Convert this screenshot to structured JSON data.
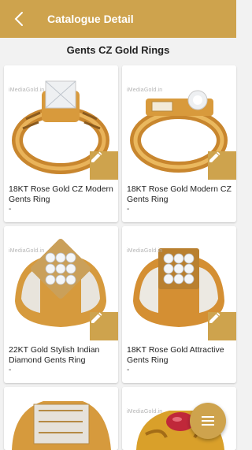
{
  "header": {
    "title": "Catalogue Detail",
    "back_icon": "back-chevron-icon"
  },
  "catalogue": {
    "title": "Gents CZ Gold Rings"
  },
  "products": [
    {
      "name": "18KT Rose Gold CZ Modern Gents Ring",
      "price": "-",
      "watermark": "iMediaGold.in"
    },
    {
      "name": "18KT Rose Gold Modern CZ Gents Ring",
      "price": "-",
      "watermark": "iMediaGold.in"
    },
    {
      "name": "22KT Gold Stylish Indian Diamond Gents Ring",
      "price": "-",
      "watermark": "iMediaGold.in"
    },
    {
      "name": "18KT Rose Gold Attractive Gents Ring",
      "price": "-",
      "watermark": "iMediaGold.in"
    },
    {
      "name": "",
      "price": "",
      "watermark": ""
    },
    {
      "name": "",
      "price": "",
      "watermark": "iMediaGold.in"
    }
  ],
  "colors": {
    "accent": "#cea34d",
    "background": "#f2f2f2",
    "gold": "#d9a441",
    "gold_dark": "#a8702a"
  },
  "fab": {
    "icon": "menu-icon"
  }
}
